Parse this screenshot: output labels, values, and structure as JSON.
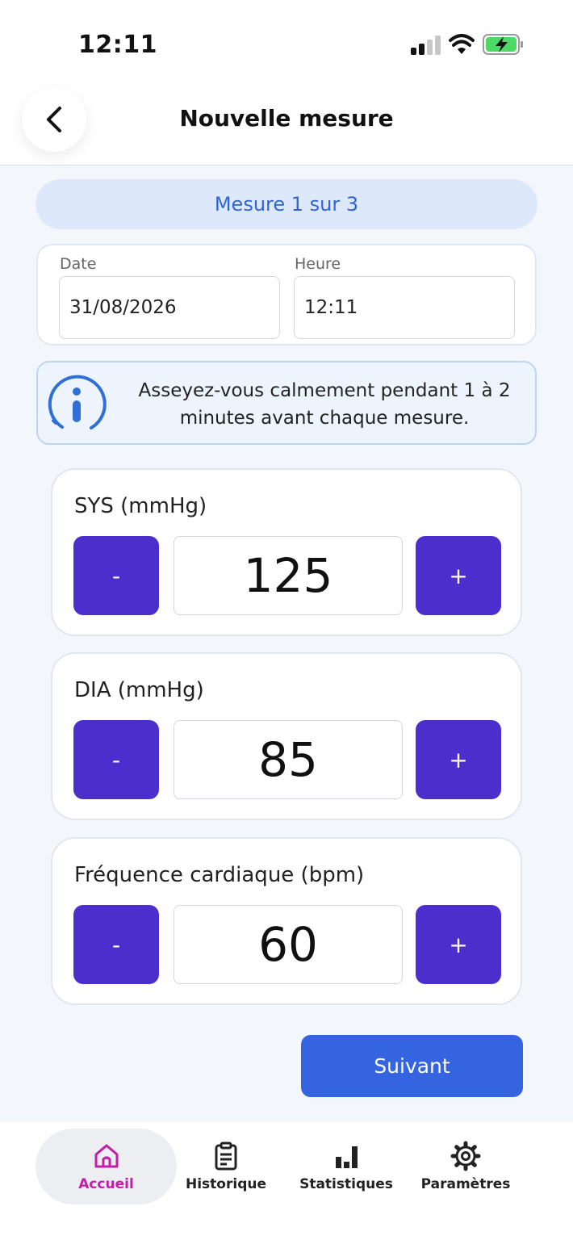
{
  "status_bar": {
    "time": "12:11"
  },
  "header": {
    "title": "Nouvelle mesure"
  },
  "progress": {
    "label": "Mesure 1 sur 3"
  },
  "datetime": {
    "date_label": "Date",
    "date_value": "31/08/2026",
    "time_label": "Heure",
    "time_value": "12:11"
  },
  "info": {
    "text": "Asseyez-vous calmement pendant 1 à 2 minutes avant chaque mesure."
  },
  "measures": [
    {
      "label": "SYS (mmHg)",
      "value": "125",
      "minus": "-",
      "plus": "+"
    },
    {
      "label": "DIA (mmHg)",
      "value": "85",
      "minus": "-",
      "plus": "+"
    },
    {
      "label": "Fréquence cardiaque (bpm)",
      "value": "60",
      "minus": "-",
      "plus": "+"
    }
  ],
  "next_button": {
    "label": "Suivant"
  },
  "tabs": [
    {
      "label": "Accueil",
      "icon": "home-icon",
      "active": true
    },
    {
      "label": "Historique",
      "icon": "clipboard-icon",
      "active": false
    },
    {
      "label": "Statistiques",
      "icon": "bar-chart-icon",
      "active": false
    },
    {
      "label": "Paramètres",
      "icon": "gear-icon",
      "active": false
    }
  ],
  "colors": {
    "accent": "#4a2fcd",
    "primary_button": "#3464e0",
    "active_tab": "#c020a8",
    "info_background": "#edf4fd",
    "battery_fill": "#4cd964"
  }
}
